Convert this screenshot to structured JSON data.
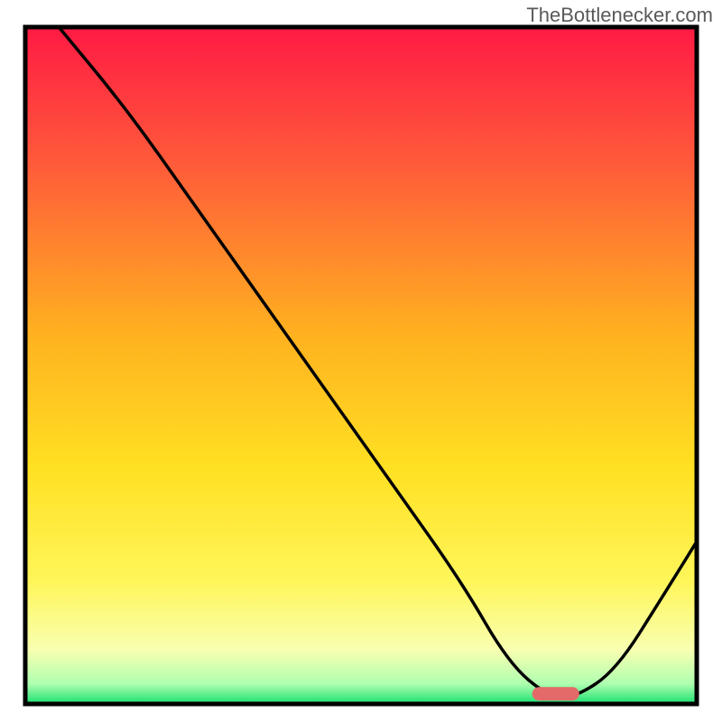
{
  "watermark": "TheBottlenecker.com",
  "chart_data": {
    "type": "line",
    "title": "",
    "xlabel": "",
    "ylabel": "",
    "xlim": [
      0,
      100
    ],
    "ylim": [
      0,
      100
    ],
    "series": [
      {
        "name": "curve",
        "x": [
          5,
          15,
          25,
          35,
          45,
          55,
          65,
          72,
          78,
          82,
          88,
          95,
          100
        ],
        "y": [
          100,
          88,
          74,
          60,
          46,
          32,
          18,
          6,
          1,
          1,
          5,
          16,
          24
        ]
      }
    ],
    "marker": {
      "x": 79,
      "y": 1.5,
      "width": 7,
      "height": 2
    },
    "background": {
      "type": "vertical-gradient",
      "stops": [
        {
          "pos": 0.0,
          "color": "#ff1a44"
        },
        {
          "pos": 0.2,
          "color": "#ff5a3a"
        },
        {
          "pos": 0.45,
          "color": "#ffb020"
        },
        {
          "pos": 0.65,
          "color": "#ffe022"
        },
        {
          "pos": 0.82,
          "color": "#fff65a"
        },
        {
          "pos": 0.92,
          "color": "#f8ffb0"
        },
        {
          "pos": 0.97,
          "color": "#b0ffb0"
        },
        {
          "pos": 1.0,
          "color": "#18e070"
        }
      ]
    },
    "frame_color": "#000000",
    "line_color": "#000000",
    "marker_color": "#e46a6a"
  }
}
